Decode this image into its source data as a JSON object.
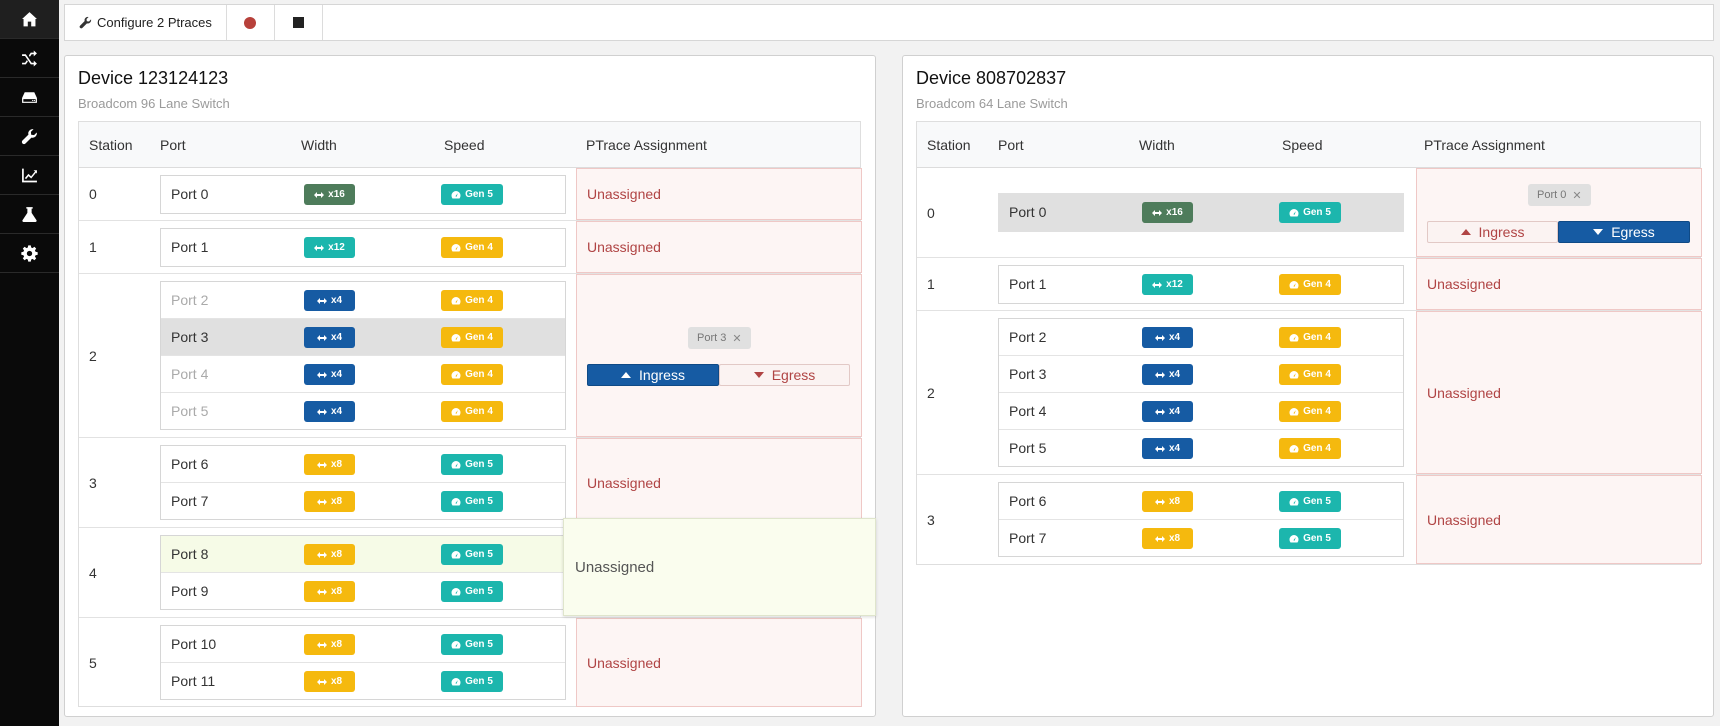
{
  "toolbar": {
    "configure_label": "Configure 2 Ptraces"
  },
  "columns": [
    "Station",
    "Port",
    "Width",
    "Speed",
    "PTrace Assignment"
  ],
  "assign": {
    "unassigned": "Unassigned",
    "ingress": "Ingress",
    "egress": "Egress"
  },
  "devices": [
    {
      "title": "Device 123124123",
      "subtitle": "Broadcom 96 Lane Switch",
      "stations": [
        {
          "num": "0",
          "ports": [
            {
              "name": "Port 0",
              "width": "x16",
              "speed": "Gen 5"
            }
          ]
        },
        {
          "num": "1",
          "ports": [
            {
              "name": "Port 1",
              "width": "x12",
              "speed": "Gen 4"
            }
          ]
        },
        {
          "num": "2",
          "ports": [
            {
              "name": "Port 2",
              "width": "x4",
              "speed": "Gen 4"
            },
            {
              "name": "Port 3",
              "width": "x4",
              "speed": "Gen 4"
            },
            {
              "name": "Port 4",
              "width": "x4",
              "speed": "Gen 4"
            },
            {
              "name": "Port 5",
              "width": "x4",
              "speed": "Gen 4"
            }
          ],
          "chip": "Port 3"
        },
        {
          "num": "3",
          "ports": [
            {
              "name": "Port 6",
              "width": "x8",
              "speed": "Gen 5"
            },
            {
              "name": "Port 7",
              "width": "x8",
              "speed": "Gen 5"
            }
          ]
        },
        {
          "num": "4",
          "ports": [
            {
              "name": "Port 8",
              "width": "x8",
              "speed": "Gen 5"
            },
            {
              "name": "Port 9",
              "width": "x8",
              "speed": "Gen 5"
            }
          ]
        },
        {
          "num": "5",
          "ports": [
            {
              "name": "Port 10",
              "width": "x8",
              "speed": "Gen 5"
            },
            {
              "name": "Port 11",
              "width": "x8",
              "speed": "Gen 5"
            }
          ]
        }
      ]
    },
    {
      "title": "Device 808702837",
      "subtitle": "Broadcom 64 Lane Switch",
      "stations": [
        {
          "num": "0",
          "ports": [
            {
              "name": "Port 0",
              "width": "x16",
              "speed": "Gen 5"
            }
          ],
          "chip": "Port 0"
        },
        {
          "num": "1",
          "ports": [
            {
              "name": "Port 1",
              "width": "x12",
              "speed": "Gen 4"
            }
          ]
        },
        {
          "num": "2",
          "ports": [
            {
              "name": "Port 2",
              "width": "x4",
              "speed": "Gen 4"
            },
            {
              "name": "Port 3",
              "width": "x4",
              "speed": "Gen 4"
            },
            {
              "name": "Port 4",
              "width": "x4",
              "speed": "Gen 4"
            },
            {
              "name": "Port 5",
              "width": "x4",
              "speed": "Gen 4"
            }
          ]
        },
        {
          "num": "3",
          "ports": [
            {
              "name": "Port 6",
              "width": "x8",
              "speed": "Gen 5"
            },
            {
              "name": "Port 7",
              "width": "x8",
              "speed": "Gen 5"
            }
          ]
        }
      ]
    }
  ]
}
